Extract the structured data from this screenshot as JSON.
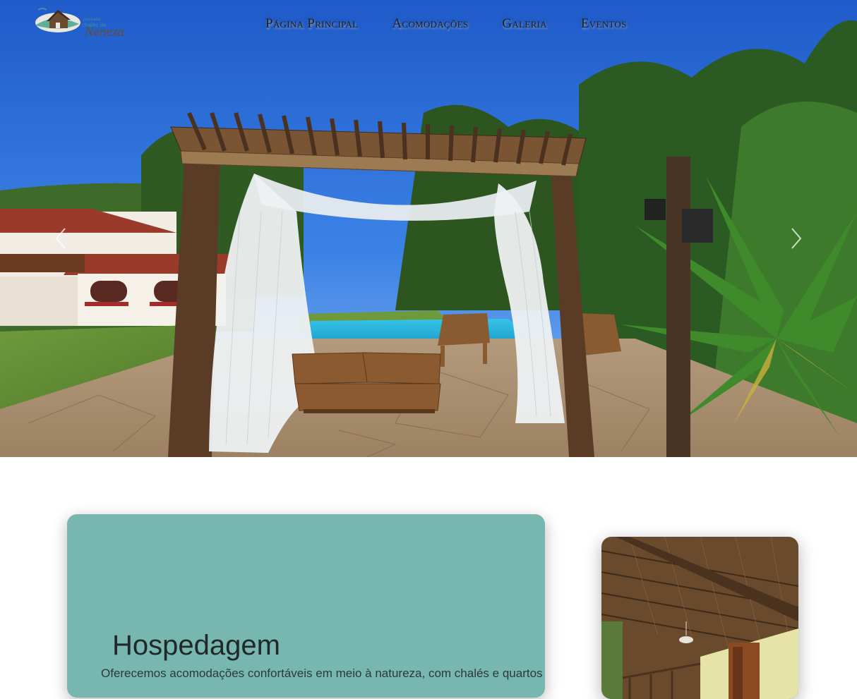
{
  "header": {
    "logo": {
      "icon": "house-on-hill-logo",
      "small_text": "pousada",
      "mid_text": "chalés da",
      "big_text": "Neneza"
    },
    "nav": [
      {
        "label": "Página Principal"
      },
      {
        "label": "Acomodações"
      },
      {
        "label": "Galeria"
      },
      {
        "label": "Eventos"
      }
    ]
  },
  "hero": {
    "image": "pergola-pool-garden-photo",
    "prev_icon": "chevron-left-icon",
    "next_icon": "chevron-right-icon"
  },
  "section": {
    "title": "Hospedagem",
    "text": "Oferecemos acomodações confortáveis em meio à natureza, com chalés e quartos",
    "image": "wooden-chalet-veranda-photo"
  },
  "colors": {
    "card_bg": "#78b6b0",
    "nav_text": "#1e1e1e",
    "sky": "#2f6fd6"
  }
}
